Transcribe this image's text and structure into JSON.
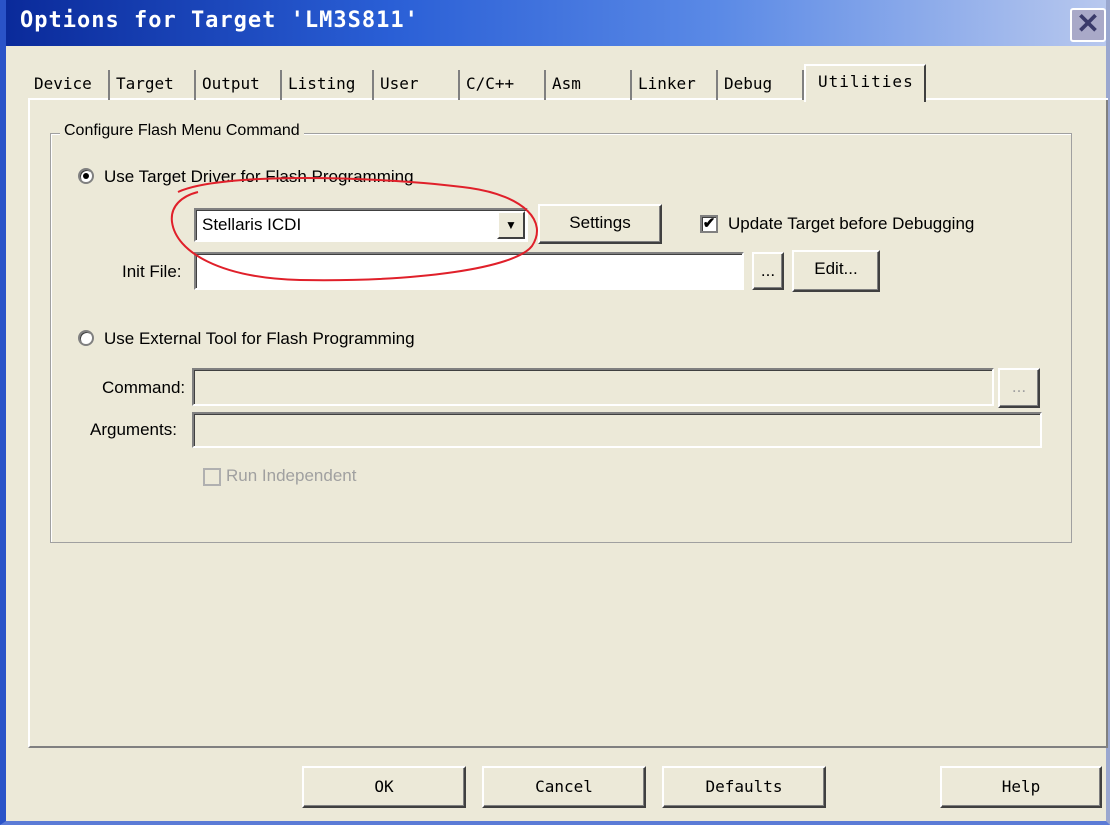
{
  "window": {
    "title": "Options for Target 'LM3S811'",
    "close_glyph": "✕",
    "accent_color": "#2a5fd6"
  },
  "tabs": [
    {
      "label": "Device",
      "active": false
    },
    {
      "label": "Target",
      "active": false
    },
    {
      "label": "Output",
      "active": false
    },
    {
      "label": "Listing",
      "active": false
    },
    {
      "label": "User",
      "active": false
    },
    {
      "label": "C/C++",
      "active": false
    },
    {
      "label": "Asm",
      "active": false
    },
    {
      "label": "Linker",
      "active": false
    },
    {
      "label": "Debug",
      "active": false
    },
    {
      "label": "Utilities",
      "active": true
    }
  ],
  "flash": {
    "group_title": "Configure Flash Menu Command",
    "use_target_driver": {
      "label": "Use Target Driver for Flash Programming",
      "selected": true,
      "driver_value": "Stellaris ICDI",
      "settings_label": "Settings",
      "update_target_label": "Update Target before Debugging",
      "update_target_checked": true,
      "init_file_label": "Init File:",
      "init_file_value": "",
      "browse_label": "...",
      "edit_label": "Edit..."
    },
    "use_external_tool": {
      "label": "Use External Tool for Flash Programming",
      "selected": false,
      "command_label": "Command:",
      "command_value": "",
      "command_browse_label": "...",
      "arguments_label": "Arguments:",
      "arguments_value": "",
      "run_independent_label": "Run Independent",
      "run_independent_checked": false
    }
  },
  "footer": {
    "ok_label": "OK",
    "cancel_label": "Cancel",
    "defaults_label": "Defaults",
    "help_label": "Help"
  },
  "annotation": {
    "color": "#e0202a"
  }
}
